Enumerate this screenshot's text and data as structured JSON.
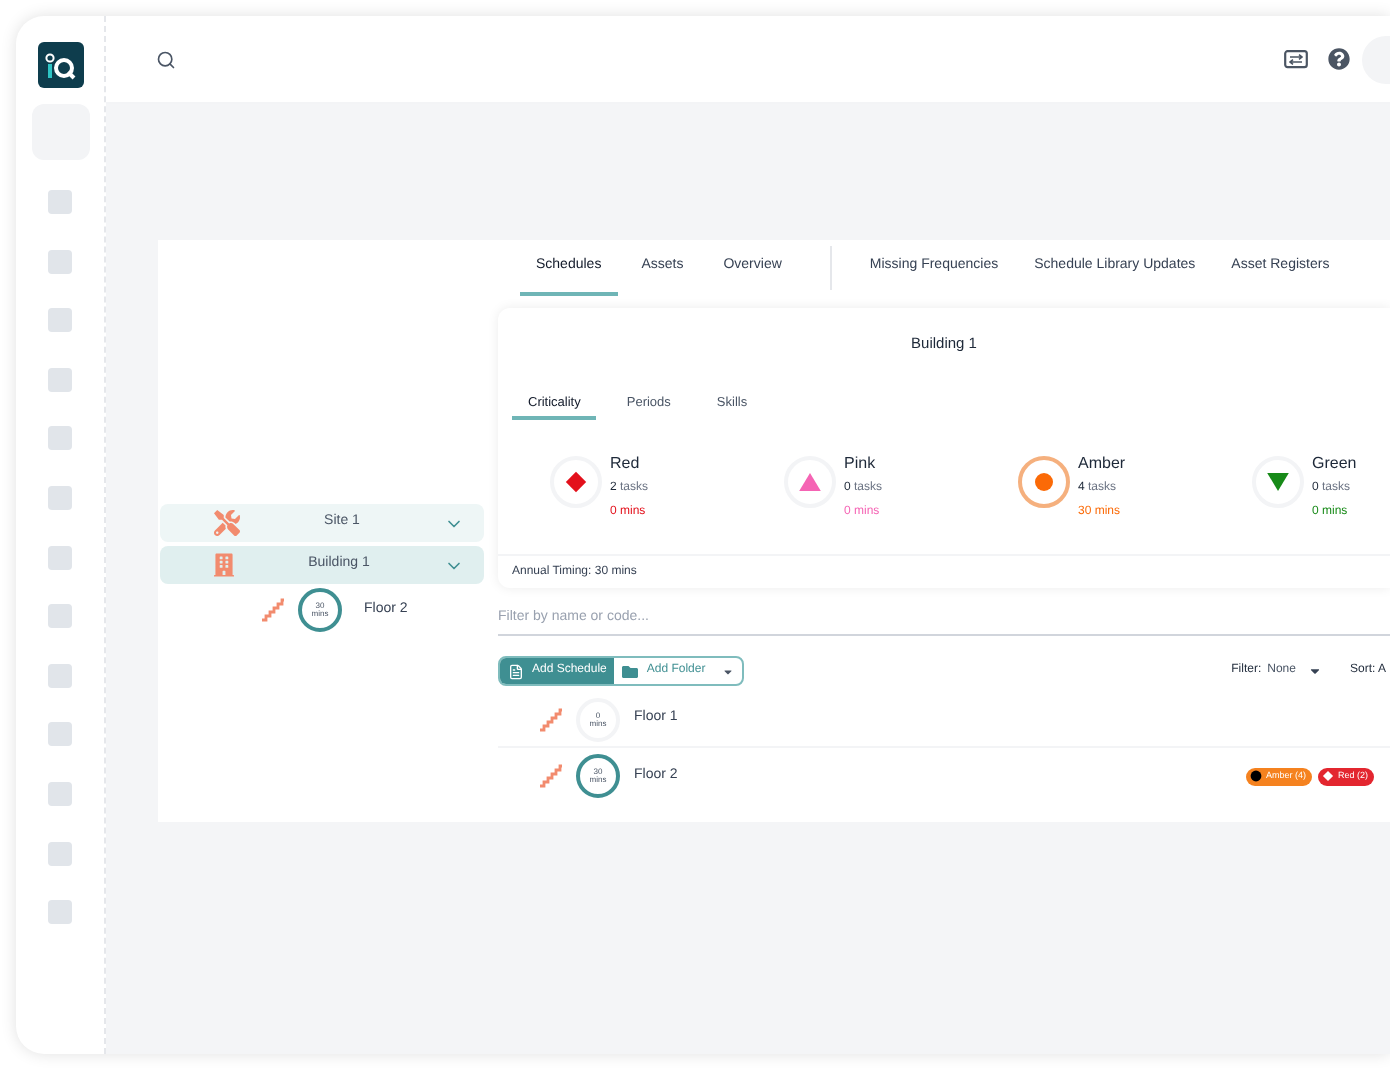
{
  "tabs": [
    {
      "label": "Schedules",
      "selected": true
    },
    {
      "label": "Assets",
      "selected": false
    },
    {
      "label": "Overview",
      "selected": false
    }
  ],
  "secondary_tabs": [
    {
      "label": "Missing Frequencies",
      "selected": false
    },
    {
      "label": "Schedule Library Updates",
      "selected": false
    },
    {
      "label": "Asset Registers",
      "selected": false
    }
  ],
  "tree": [
    {
      "label": "Site 1",
      "kind": "site",
      "expanded": true,
      "selected": false,
      "children": [
        {
          "label": "Building 1",
          "kind": "building",
          "expanded": true,
          "selected": true,
          "children": [
            {
              "label": "Floor 2",
              "kind": "floor",
              "timing": "30",
              "unit": "mins",
              "active": true
            }
          ]
        }
      ]
    }
  ],
  "summary": {
    "title": "Building 1",
    "tabs": [
      {
        "label": "Criticality",
        "selected": true
      },
      {
        "label": "Periods",
        "selected": false
      },
      {
        "label": "Skills",
        "selected": false
      }
    ],
    "criticality": [
      {
        "name": "Red",
        "kind": "diamond",
        "color": "#e3101b",
        "count": "2",
        "count_label": "tasks",
        "mins": "0 mins",
        "selected": false
      },
      {
        "name": "Pink",
        "kind": "triangle",
        "color": "#f564b4",
        "count": "0",
        "count_label": "tasks",
        "mins": "0 mins",
        "selected": false
      },
      {
        "name": "Amber",
        "kind": "circle",
        "color": "#fb6a07",
        "count": "4",
        "count_label": "tasks",
        "mins": "30 mins",
        "selected": true
      },
      {
        "name": "Green",
        "kind": "down-triangle",
        "color": "#178a18",
        "count": "0",
        "count_label": "tasks",
        "mins": "0 mins",
        "selected": false
      }
    ],
    "annual_timing": "Annual Timing: 30 mins"
  },
  "filter_field": {
    "placeholder": "Filter by name or code..."
  },
  "add_schedule": "Add Schedule",
  "add_folder": "Add Folder",
  "filter": {
    "label": "Filter:",
    "value": "None"
  },
  "sort": "Sort: A",
  "rows": [
    {
      "name": "Floor 1",
      "timing": "0",
      "unit": "mins",
      "active": false,
      "tags": []
    },
    {
      "name": "Floor 2",
      "timing": "30",
      "unit": "mins",
      "active": true,
      "tags": [
        {
          "label": "Amber (4)",
          "kind": "circle",
          "color": "#f5821f"
        },
        {
          "label": "Red (2)",
          "kind": "diamond",
          "color": "#e3262f"
        }
      ]
    }
  ]
}
